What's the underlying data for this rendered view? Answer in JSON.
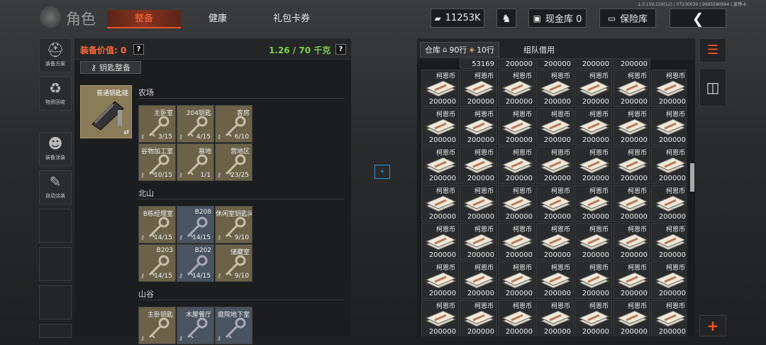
{
  "version": "1.0.159.159(12) | 07230039 | 9695580994 | 盖博-6",
  "title": "角色",
  "tabs": [
    {
      "label": "整备",
      "active": true
    },
    {
      "label": "健康"
    },
    {
      "label": "礼包卡券"
    }
  ],
  "top": {
    "money": "11253K",
    "cash_vault": "现金库 0",
    "safe": "保险库"
  },
  "sidebar": [
    {
      "label": "装备方案"
    },
    {
      "label": "物资回收"
    },
    {
      "label": "装备涂装"
    },
    {
      "label": "自动涂装"
    }
  ],
  "equip": {
    "value_label": "装备价值: 0",
    "weight": "1.26 / 70 千克"
  },
  "key_button": "钥匙整备",
  "keychain": {
    "name": "普通钥匙链"
  },
  "sections": [
    {
      "name": "农场",
      "keys": [
        {
          "name": "主卧室",
          "count": "3/15",
          "color": "gold"
        },
        {
          "name": "204钥匙",
          "count": "4/15",
          "color": "gold"
        },
        {
          "name": "客房",
          "count": "6/10",
          "color": "gold"
        },
        {
          "name": "谷物加工室",
          "count": "10/15",
          "color": "gold"
        },
        {
          "name": "墓地",
          "count": "1/1",
          "color": "gold"
        },
        {
          "name": "营地区",
          "count": "23/25",
          "color": "gold"
        }
      ]
    },
    {
      "name": "北山",
      "keys": [
        {
          "name": "B栋经理室",
          "count": "14/15",
          "color": "gold"
        },
        {
          "name": "B208",
          "count": "14/15",
          "color": "blue"
        },
        {
          "name": "休闲室钥匙间",
          "count": "9/10",
          "color": "gold"
        },
        {
          "name": "B203",
          "count": "14/15",
          "color": "gold"
        },
        {
          "name": "B202",
          "count": "14/15",
          "color": "blue"
        },
        {
          "name": "储藏室",
          "count": "9/10",
          "color": "gold"
        }
      ]
    },
    {
      "name": "山谷",
      "keys": [
        {
          "name": "主卧钥匙",
          "count": "",
          "color": "gold"
        },
        {
          "name": "木屋餐厅",
          "count": "",
          "color": "blue"
        },
        {
          "name": "庭院地下室",
          "count": "",
          "color": "blue"
        }
      ]
    }
  ],
  "warehouse": {
    "tab": "仓库",
    "rows": "90行",
    "rows2": "10行",
    "team": "组队借用"
  },
  "grid": {
    "top_row": [
      "53169",
      "200000",
      "200000",
      "200000",
      "200000"
    ],
    "cell_name": "柯恩币",
    "cell_value": "200000",
    "rows": 7,
    "cols": 7
  }
}
